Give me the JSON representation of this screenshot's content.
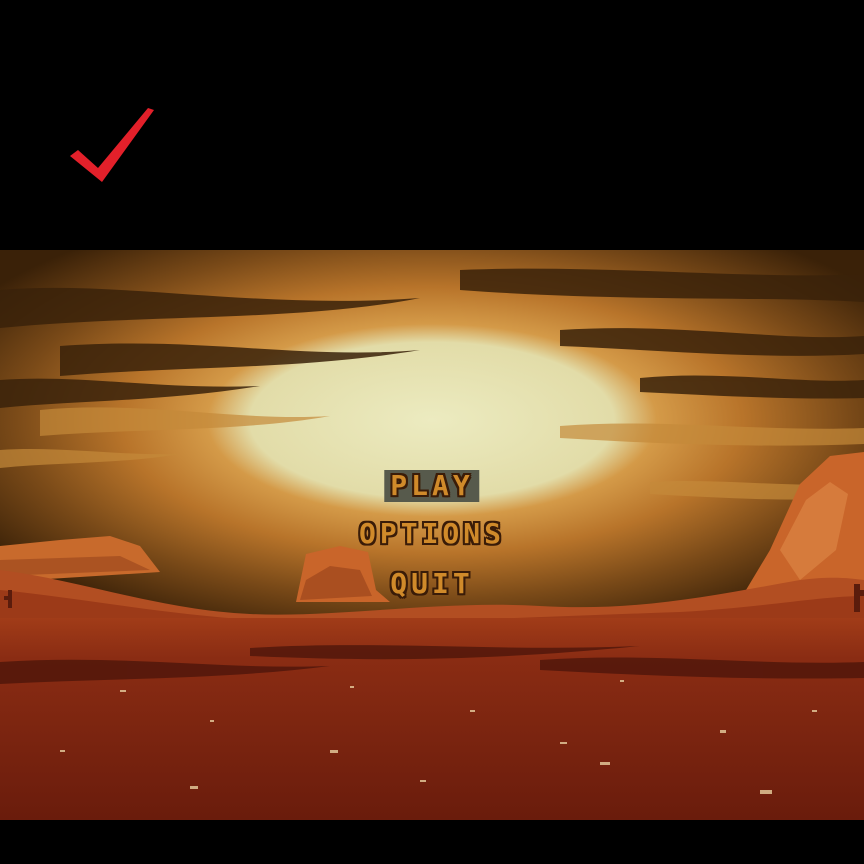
{
  "menu": {
    "items": [
      {
        "label": "PLAY",
        "selected": true
      },
      {
        "label": "OPTIONS",
        "selected": false
      },
      {
        "label": "QUIT",
        "selected": false
      }
    ]
  },
  "icons": {
    "top_left": "checkmark-icon"
  },
  "colors": {
    "background": "#000000",
    "menu_text": "#d08a2a",
    "menu_outline": "#3a1c08",
    "selection_highlight": "#575a4c",
    "checkmark": "#e3202a",
    "sky_glow": "#e6e4b4",
    "desert_ground": "#7e2411"
  }
}
